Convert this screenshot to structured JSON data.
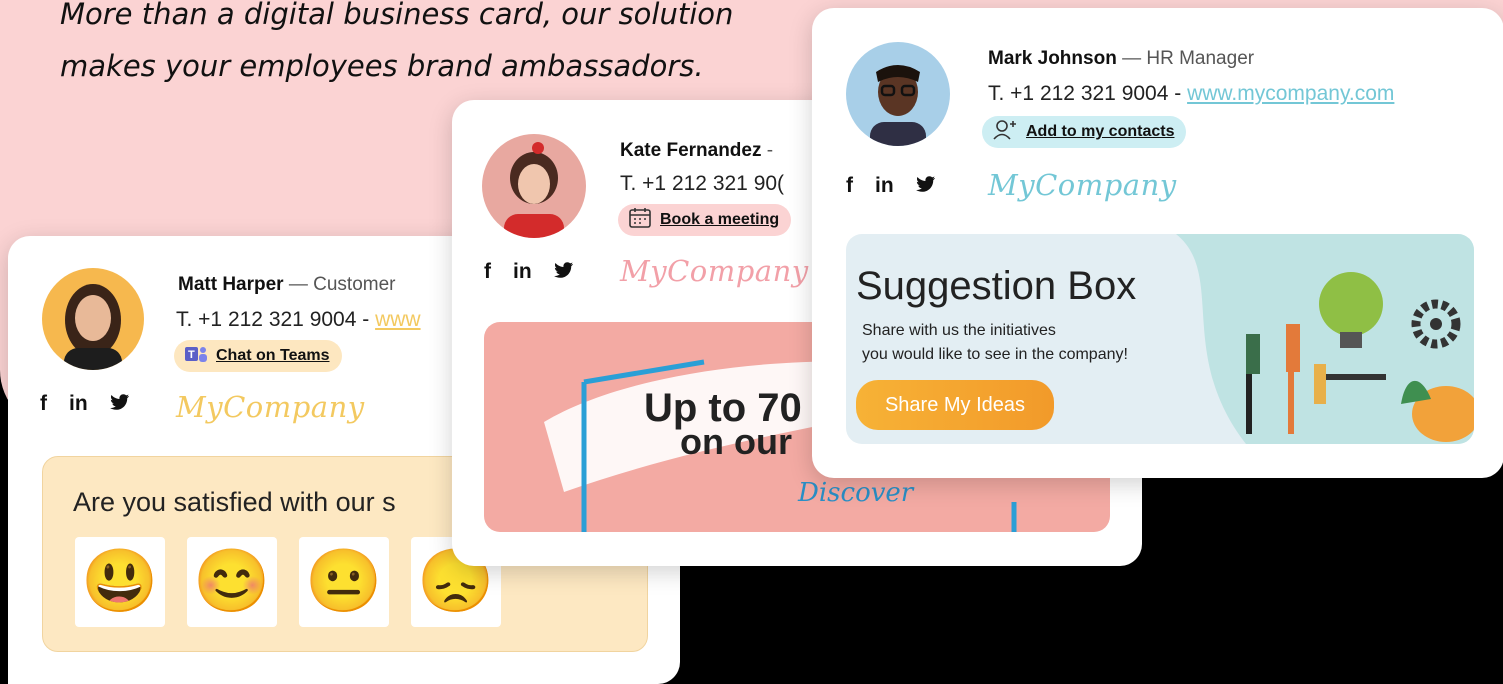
{
  "tagline": {
    "line1": "More than a digital business card, our solution",
    "line2": "makes your employees brand ambassadors."
  },
  "social_icons": {
    "facebook": "f",
    "linkedin": "in",
    "twitter": "twitter-icon"
  },
  "colors": {
    "pink_bg": "#fbd3d3",
    "teal_accent": "#73c7d6",
    "pink_accent": "#f2a8a8",
    "yellow_accent": "#f3c960",
    "cta_orange": "#f29a2a"
  },
  "card1": {
    "name": "Matt Harper",
    "role": "— Customer",
    "phone": "T. +1 212 321 9004 - ",
    "url": "www",
    "action_label": "Chat on Teams",
    "action_icon": "teams-icon",
    "brand": "MyCompany",
    "survey_question": "Are you satisfied with our s",
    "emojis": [
      "😃",
      "😊",
      "😐",
      "😞"
    ]
  },
  "card2": {
    "name": "Kate Fernandez",
    "role": "-",
    "phone": "T. +1 212 321 90(",
    "action_label": "Book a meeting",
    "action_icon": "calendar-icon",
    "brand": "MyCompany",
    "promo_line1": "Up to 70",
    "promo_line2": "on our",
    "promo_link": "Discover"
  },
  "card3": {
    "name": "Mark Johnson",
    "role": "— HR Manager",
    "phone": "T. +1 212 321 9004 - ",
    "url": "www.mycompany.com",
    "action_label": "Add to my contacts",
    "action_icon": "add-contact-icon",
    "brand": "MyCompany",
    "banner_title": "Suggestion Box",
    "banner_line1": "Share with us the initiatives",
    "banner_line2": "you would like to see in the company!",
    "cta_label": "Share My Ideas"
  }
}
